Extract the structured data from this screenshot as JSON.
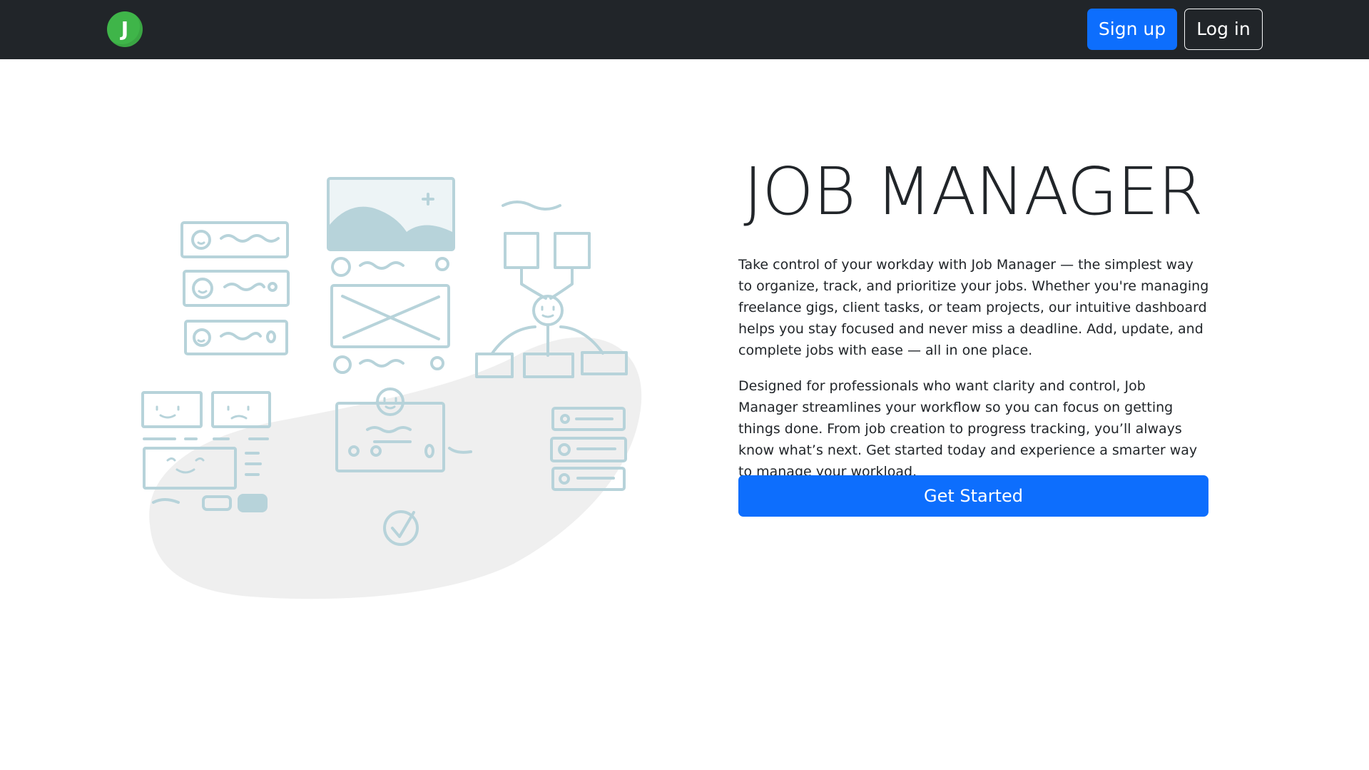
{
  "navbar": {
    "logo_letter": "J",
    "signup_label": "Sign up",
    "login_label": "Log in"
  },
  "hero": {
    "title": "JOB MANAGER",
    "paragraph1": "Take control of your workday with Job Manager — the simplest way to organize, track, and prioritize your jobs. Whether you're managing freelance gigs, client tasks, or team projects, our intuitive dashboard helps you stay focused and never miss a deadline. Add, update, and complete jobs with ease — all in one place.",
    "paragraph2": "Designed for professionals who want clarity and control, Job Manager streamlines your workflow so you can focus on getting things done. From job creation to progress tracking, you’ll always know what’s next. Get started today and experience a smarter way to manage your workload.",
    "cta_label": "Get Started"
  },
  "colors": {
    "navbar_bg": "#212529",
    "accent": "#0d6efd",
    "logo_bg": "#3fb549",
    "illustration_stroke": "#b7d3da",
    "blob": "#efefef"
  },
  "icons": {
    "logo": "j-logo-icon",
    "illustration": "dashboard-sketch-illustration"
  }
}
